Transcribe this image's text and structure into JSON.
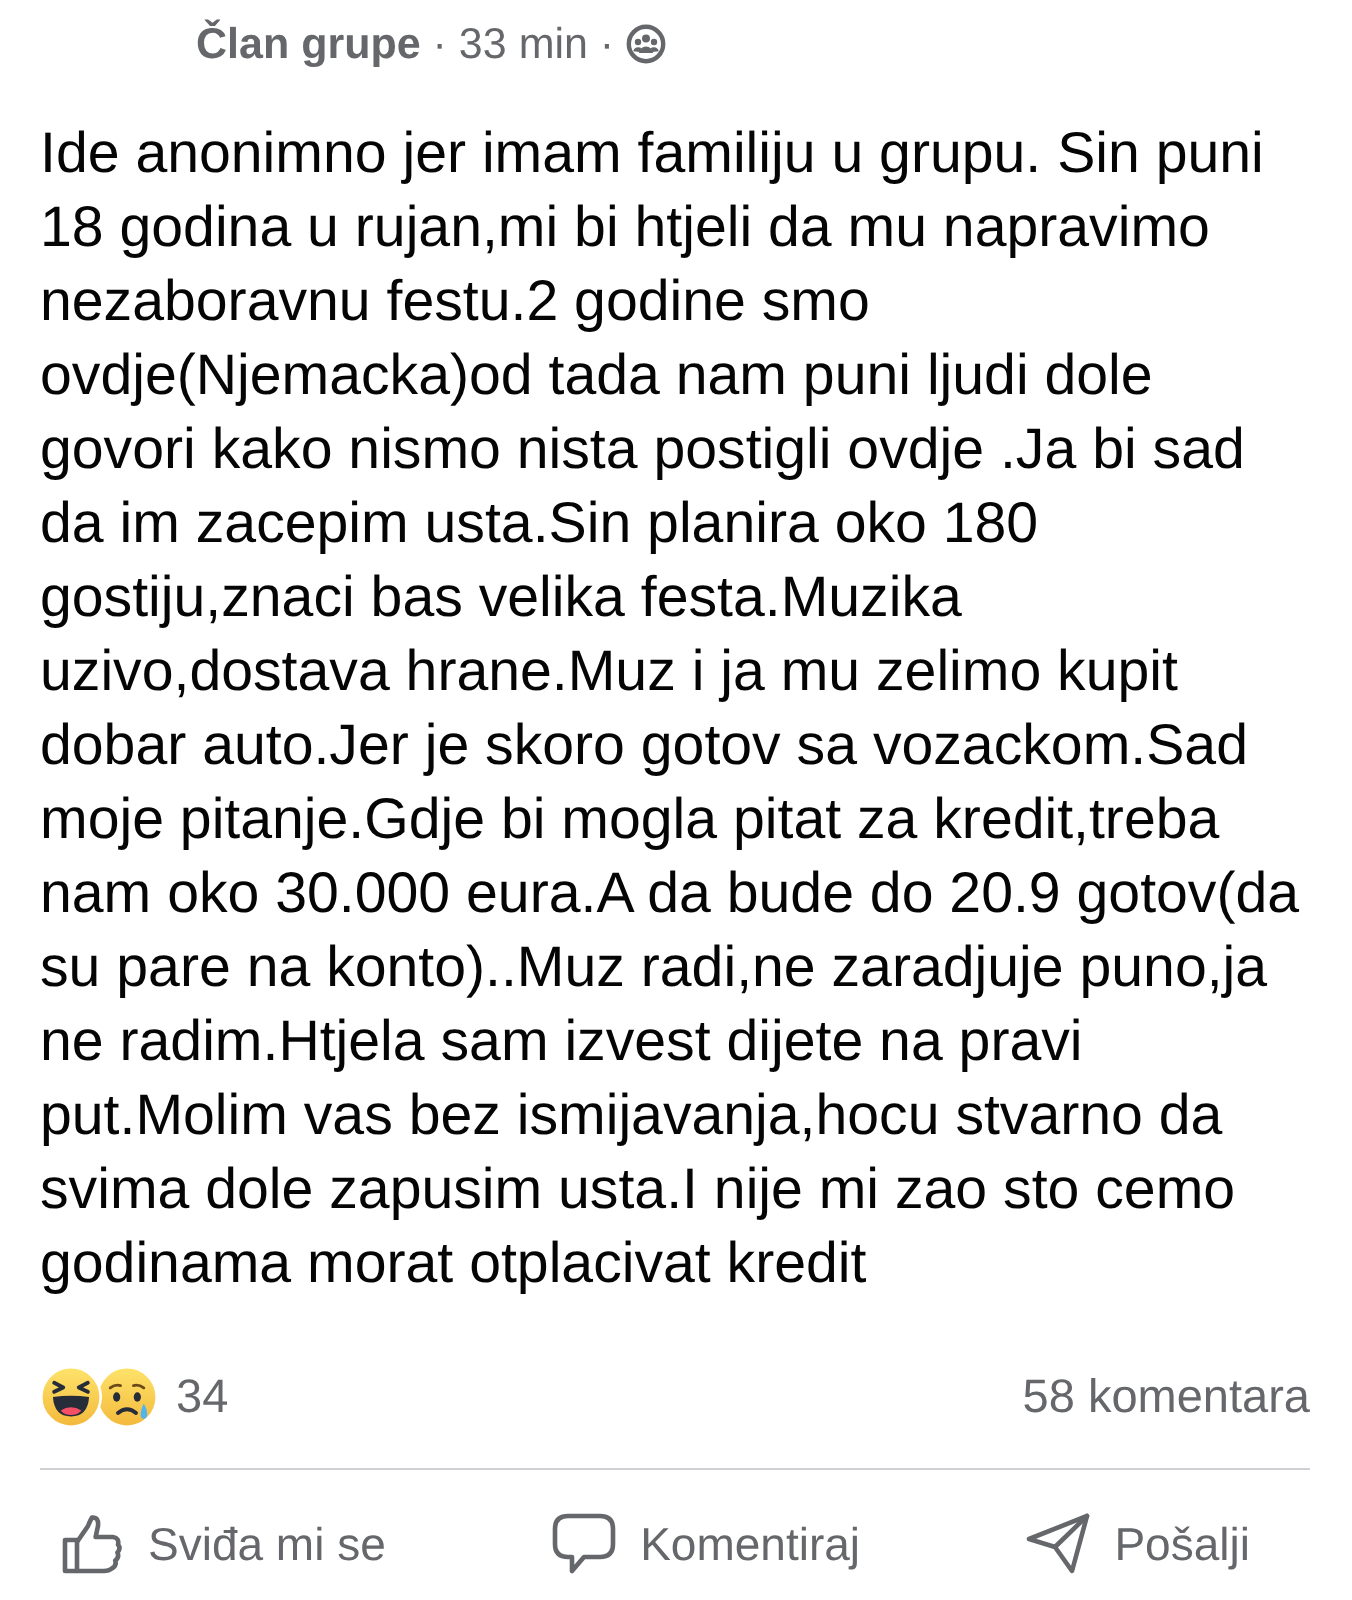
{
  "post": {
    "author": "Član grupe",
    "meta": "· 33 min ·",
    "body": "Ide anonimno jer imam familiju u grupu. Sin puni 18 godina u rujan,mi bi htjeli da mu napravimo nezaboravnu festu.2 godine smo ovdje(Njemacka)od tada nam puni ljudi dole govori kako nismo nista postigli ovdje .Ja bi sad da im zacepim usta.Sin planira oko 180 gostiju,znaci bas velika festa.Muzika uzivo,dostava hrane.Muz i ja mu zelimo kupit dobar auto.Jer je skoro gotov sa vozackom.Sad moje pitanje.Gdje bi mogla pitat za kredit,treba nam oko 30.000 eura.A da bude do 20.9 gotov(da su pare na konto)..Muz radi,ne zaradjuje puno,ja ne radim.Htjela sam izvest dijete na pravi put.Molim vas bez ismijavanja,hocu stvarno da svima dole zapusim usta.I nije mi zao sto cemo godinama morat otplacivat kredit",
    "reactions": {
      "types": [
        {
          "kind": "haha"
        },
        {
          "kind": "sad"
        }
      ],
      "count": "34"
    },
    "comments": "58 komentara"
  },
  "actions": [
    {
      "kind": "like",
      "label": "Sviđa mi se"
    },
    {
      "kind": "comment",
      "label": "Komentiraj"
    },
    {
      "kind": "share",
      "label": "Pošalji"
    }
  ]
}
